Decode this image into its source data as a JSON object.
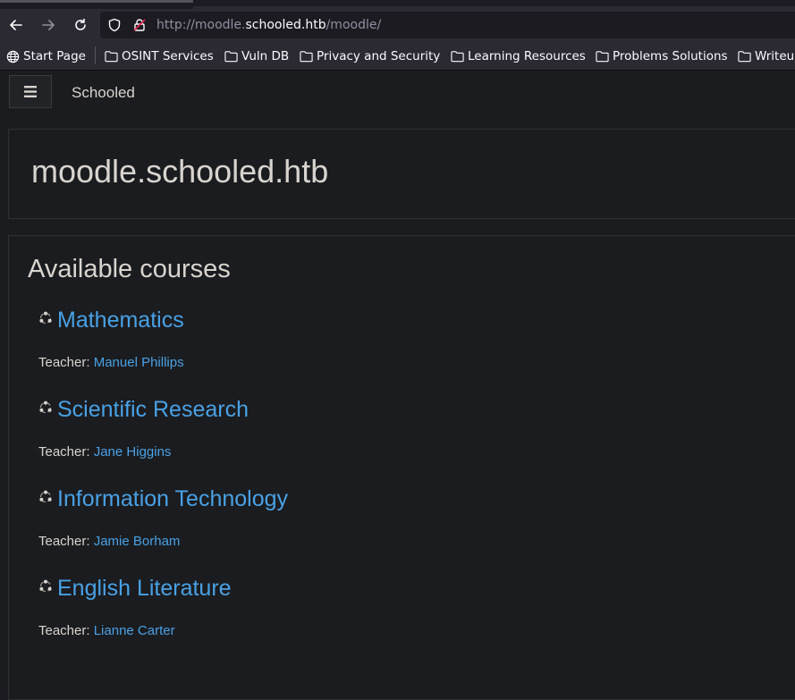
{
  "browser": {
    "url_prefix": "http://moodle.",
    "url_host": "schooled.htb",
    "url_path": "/moodle/"
  },
  "bookmarks": [
    {
      "label": "Start Page",
      "icon": "globe-icon"
    },
    {
      "label": "OSINT Services",
      "icon": "folder-icon"
    },
    {
      "label": "Vuln DB",
      "icon": "folder-icon"
    },
    {
      "label": "Privacy and Security",
      "icon": "folder-icon"
    },
    {
      "label": "Learning Resources",
      "icon": "folder-icon"
    },
    {
      "label": "Problems Solutions",
      "icon": "folder-icon"
    },
    {
      "label": "Writeups",
      "icon": "folder-icon"
    }
  ],
  "site": {
    "name": "Schooled",
    "heading": "moodle.schooled.htb"
  },
  "courses_section": {
    "title": "Available courses",
    "teacher_label": "Teacher: ",
    "courses": [
      {
        "name": "Mathematics",
        "teacher": "Manuel Phillips"
      },
      {
        "name": "Scientific Research",
        "teacher": "Jane Higgins"
      },
      {
        "name": "Information Technology",
        "teacher": "Jamie Borham"
      },
      {
        "name": "English Literature",
        "teacher": "Lianne Carter"
      }
    ]
  },
  "colors": {
    "link": "#48a1e5",
    "text": "#d8d4cf",
    "background": "#1b1c1f"
  }
}
